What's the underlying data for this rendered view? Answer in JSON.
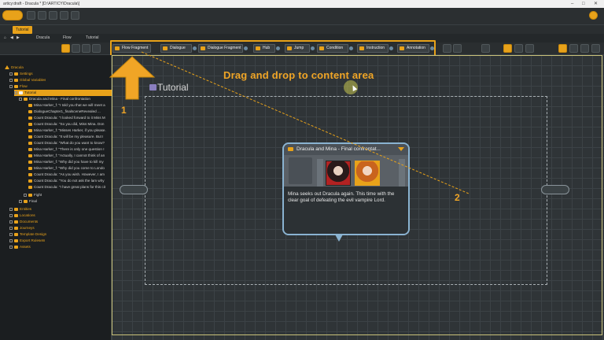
{
  "window": {
    "title": "articy:draft - Dracula * [D:\\ARTICY\\Dracula\\]"
  },
  "tabs": [
    {
      "label": "Tutorial"
    }
  ],
  "breadcrumb": {
    "items": [
      "Dracula",
      "Flow",
      "Tutorial"
    ]
  },
  "palette": {
    "items": [
      {
        "label": "Flow Fragment"
      },
      {
        "label": "Dialogue"
      },
      {
        "label": "Dialogue Fragment"
      },
      {
        "label": "Hub"
      },
      {
        "label": "Jump"
      },
      {
        "label": "Condition"
      },
      {
        "label": "Instruction"
      },
      {
        "label": "Annotation"
      }
    ]
  },
  "tree": {
    "items": [
      {
        "label": "Dracula"
      },
      {
        "label": "Settings"
      },
      {
        "label": "Global Variables"
      },
      {
        "label": "Flow"
      },
      {
        "label": "Tutorial"
      },
      {
        "label": "Dracula and Mina - Final confrontation"
      },
      {
        "label": "Mina Harker_f: \"I told you that we will meet a"
      },
      {
        "label": "DialogueChapter1_finalsceneRevealed ..."
      },
      {
        "label": "Count Dracula: \"I looked forward to it Miss M"
      },
      {
        "label": "Count Dracula: \"So you did, Miss Mina. Don"
      },
      {
        "label": "Mina Harker_f: \"Misses Harker, if you please."
      },
      {
        "label": "Count Dracula: \"It will be my pleasure. But I"
      },
      {
        "label": "Count Dracula: \"What do you want to know?"
      },
      {
        "label": "Mina Harker_f: \"There is only one question I"
      },
      {
        "label": "Mina Harker_f: \"Actually, I cannot think of an"
      },
      {
        "label": "Mina Harker_f: \"Why did you have to kill my"
      },
      {
        "label": "Mina Harker_f: \"Why did you come to Londo"
      },
      {
        "label": "Count Dracula: \"As you wish. However, I am"
      },
      {
        "label": "Count Dracula: \"You do not ask the lam why"
      },
      {
        "label": "Count Dracula: \"I have great plans for this cit"
      },
      {
        "label": "Fight"
      },
      {
        "label": "Final"
      },
      {
        "label": "Entities"
      },
      {
        "label": "Locations"
      },
      {
        "label": "Documents"
      },
      {
        "label": "Journeys"
      },
      {
        "label": "Template Design"
      },
      {
        "label": "Export Rulesets"
      },
      {
        "label": "Assets"
      }
    ]
  },
  "annotations": {
    "drag_text": "Drag and drop to content area",
    "marker_1": "1",
    "marker_2": "2"
  },
  "canvas": {
    "title": "Tutorial"
  },
  "node": {
    "title": "Dracula and Mina - Final confrontat...",
    "body": "Mina seeks out Dracula again. This time with the clear goal of defeating the evil vampire Lord."
  },
  "colors": {
    "accent": "#e8a21a",
    "node_border": "#8ab3d1",
    "canvas_bg": "#2f3437"
  }
}
